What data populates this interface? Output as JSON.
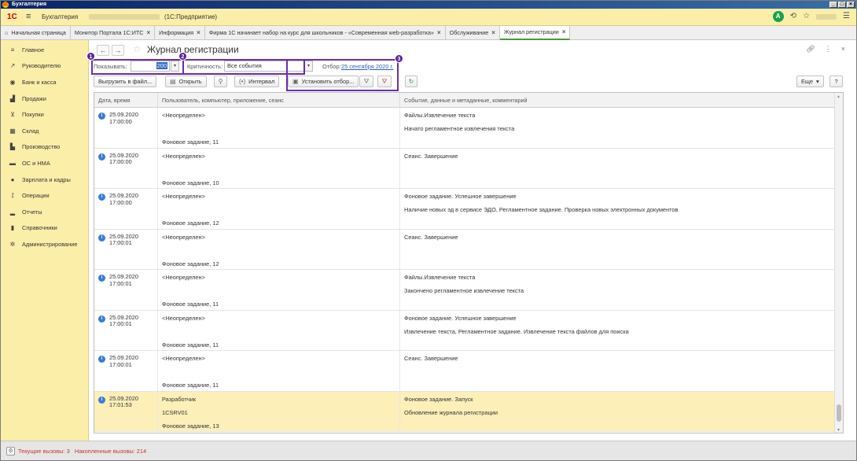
{
  "window": {
    "title": "Бухгалтерия"
  },
  "appbar": {
    "brand": "1С",
    "app_name": "Бухгалтерия",
    "mode": "(1С:Предприятие)",
    "user_badge": "A"
  },
  "tabs": [
    {
      "label": "Начальная страница",
      "closable": false
    },
    {
      "label": "Монитор Портала 1С:ИТС",
      "closable": true
    },
    {
      "label": "Информация",
      "closable": true
    },
    {
      "label": "Фирма 1С начинает набор на курс для школьников - «Современная web-разработка»",
      "closable": true
    },
    {
      "label": "Обслуживание",
      "closable": true
    },
    {
      "label": "Журнал регистрации",
      "closable": true,
      "active": true
    }
  ],
  "sidebar": {
    "items": [
      {
        "label": "Главное",
        "icon": "menu-lines-icon"
      },
      {
        "label": "Руководителю",
        "icon": "trend-chart-icon"
      },
      {
        "label": "Банк и касса",
        "icon": "bank-coin-icon"
      },
      {
        "label": "Продажи",
        "icon": "shopping-bag-icon"
      },
      {
        "label": "Покупки",
        "icon": "shopping-cart-icon"
      },
      {
        "label": "Склад",
        "icon": "warehouse-icon"
      },
      {
        "label": "Производство",
        "icon": "factory-icon"
      },
      {
        "label": "ОС и НМА",
        "icon": "truck-icon"
      },
      {
        "label": "Зарплата и кадры",
        "icon": "person-icon"
      },
      {
        "label": "Операции",
        "icon": "operations-icon"
      },
      {
        "label": "Отчеты",
        "icon": "bar-chart-icon"
      },
      {
        "label": "Справочники",
        "icon": "book-icon"
      },
      {
        "label": "Администрирование",
        "icon": "gear-icon"
      }
    ]
  },
  "form": {
    "title": "Журнал регистрации",
    "show_label": "Показывать:",
    "show_value": "200",
    "criticality_label": "Критичность:",
    "criticality_value": "Все события",
    "filter_label": "Отбор:",
    "filter_value": "25 сентября 2020 г."
  },
  "callouts": [
    "1",
    "2",
    "3"
  ],
  "toolbar": {
    "export": "Выгрузить в файл...",
    "open": "Открыть",
    "interval": "Интервал",
    "set_filter": "Установить отбор...",
    "more": "Еще",
    "help": "?"
  },
  "grid": {
    "columns": [
      "Дата, время",
      "Пользователь, компьютер, приложение, сеанс",
      "Событие, данные и метаданные, комментарий"
    ],
    "rows": [
      {
        "date": "25.09.2020",
        "time": "17:00:00",
        "user": "<Неопределен>",
        "computer": "",
        "session": "Фоновое задание, 11",
        "event": "Файлы.Извлечение текста",
        "data": "Начато регламентное извлечения текста",
        "highlight": false
      },
      {
        "date": "25.09.2020",
        "time": "17:00:00",
        "user": "<Неопределен>",
        "computer": "",
        "session": "Фоновое задание, 10",
        "event": "Сеанс. Завершение",
        "data": "",
        "highlight": false
      },
      {
        "date": "25.09.2020",
        "time": "17:00:00",
        "user": "<Неопределен>",
        "computer": "",
        "session": "Фоновое задание, 12",
        "event": "Фоновое задание. Успешное завершение",
        "data": "Наличие новых эд в сервисе ЭДО, Регламентное задание. Проверка новых электронных документов",
        "highlight": false
      },
      {
        "date": "25.09.2020",
        "time": "17:00:01",
        "user": "<Неопределен>",
        "computer": "",
        "session": "Фоновое задание, 12",
        "event": "Сеанс. Завершение",
        "data": "",
        "highlight": false
      },
      {
        "date": "25.09.2020",
        "time": "17:00:01",
        "user": "<Неопределен>",
        "computer": "",
        "session": "Фоновое задание, 11",
        "event": "Файлы.Извлечение текста",
        "data": "Закончено регламентное извлечение текста",
        "highlight": false
      },
      {
        "date": "25.09.2020",
        "time": "17:00:01",
        "user": "<Неопределен>",
        "computer": "",
        "session": "Фоновое задание, 11",
        "event": "Фоновое задание. Успешное завершение",
        "data": "Извлечение текста, Регламентное задание. Извлечение текста файлов для поиска",
        "highlight": false
      },
      {
        "date": "25.09.2020",
        "time": "17:00:01",
        "user": "<Неопределен>",
        "computer": "",
        "session": "Фоновое задание, 11",
        "event": "Сеанс. Завершение",
        "data": "",
        "highlight": false
      },
      {
        "date": "25.09.2020",
        "time": "17:01:53",
        "user": "Разработчик",
        "computer": "1CSRV01",
        "session": "Фоновое задание, 13",
        "event": "Фоновое задание. Запуск",
        "data": "Обновление журнала регистрации",
        "highlight": true
      }
    ]
  },
  "status": {
    "text": "Текущие вызовы: 3   Накопленные вызовы: 214"
  },
  "colors": {
    "panel": "#fbeea8",
    "callout": "#6a2ea8",
    "link": "#2d63b9",
    "status_text": "#c0392b",
    "highlight_row": "#fcefb8"
  }
}
